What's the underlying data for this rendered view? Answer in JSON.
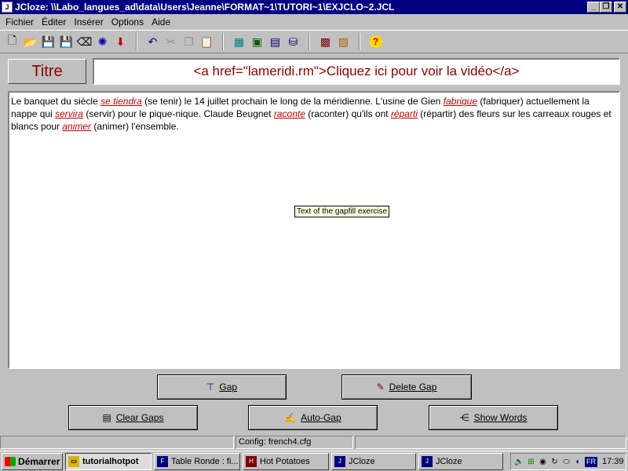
{
  "window": {
    "title": "JCloze: \\\\Labo_langues_ad\\data\\Users\\Jeanne\\FORMAT~1\\TUTORI~1\\EXJCLO~2.JCL"
  },
  "menu": [
    "Fichier",
    "Éditer",
    "Insérer",
    "Options",
    "Aide"
  ],
  "title_label": "Titre",
  "title_value": "<a href=\"lameridi.rm\">Cliquez ici pour voir la vidéo</a>",
  "exercise": {
    "segments": [
      {
        "t": "Le banquet du siècle "
      },
      {
        "g": "se tiendra"
      },
      {
        "t": " (se tenir) le 14 juillet prochain le long de la méridienne. L'usine de Gien "
      },
      {
        "g": "fabrique"
      },
      {
        "t": " (fabriquer) actuellement la nappe qui "
      },
      {
        "g": "servira"
      },
      {
        "t": " (servir) pour le pique-nique. Claude Beugnet "
      },
      {
        "g": "raconte"
      },
      {
        "t": " (raconter) qu'ils ont "
      },
      {
        "g": "réparti"
      },
      {
        "t": " (répartir) des fleurs sur les carreaux rouges et blancs pour "
      },
      {
        "g": "animer"
      },
      {
        "t": " (animer) l'ensemble."
      }
    ]
  },
  "tooltip": "Text of the gapfill exercise",
  "buttons": {
    "gap": "Gap",
    "delete_gap": "Delete Gap",
    "clear_gaps": "Clear Gaps",
    "auto_gap": "Auto-Gap",
    "show_words": "Show Words"
  },
  "status": {
    "config": "Config: french4.cfg"
  },
  "taskbar": {
    "start": "Démarrer",
    "tasks": [
      "tutorialhotpot",
      "Table Ronde : fi...",
      "Hot Potatoes",
      "JCloze",
      "JCloze"
    ],
    "lang": "FR",
    "clock": "17:39"
  },
  "colors": {
    "titlebar": "#000080",
    "accent_text": "#8b0000",
    "gap_text": "#c00000",
    "tooltip_bg": "#ffffe1"
  }
}
